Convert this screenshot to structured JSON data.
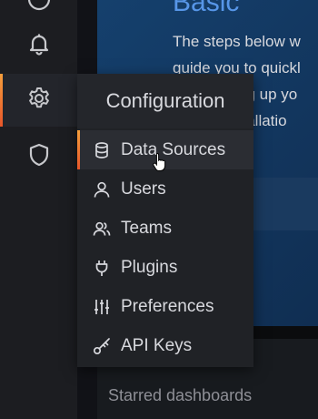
{
  "sidebar": {
    "icons": [
      "bell-icon",
      "gear-icon",
      "shield-icon"
    ]
  },
  "menu": {
    "header": "Configuration",
    "items": [
      {
        "label": "Data Sources",
        "icon": "database-icon",
        "active": true
      },
      {
        "label": "Users",
        "icon": "user-icon"
      },
      {
        "label": "Teams",
        "icon": "users-icon"
      },
      {
        "label": "Plugins",
        "icon": "plug-icon"
      },
      {
        "label": "Preferences",
        "icon": "sliders-icon"
      },
      {
        "label": "API Keys",
        "icon": "key-icon"
      }
    ]
  },
  "main": {
    "hero_title": "Basic",
    "hero_text_lines": [
      "The steps below w",
      "guide you to quickl",
      "ng up yo",
      "stallatio"
    ],
    "starred_title": "Starred dashboards"
  },
  "colors": {
    "accent": "#f5862a",
    "link": "#5796e8"
  }
}
